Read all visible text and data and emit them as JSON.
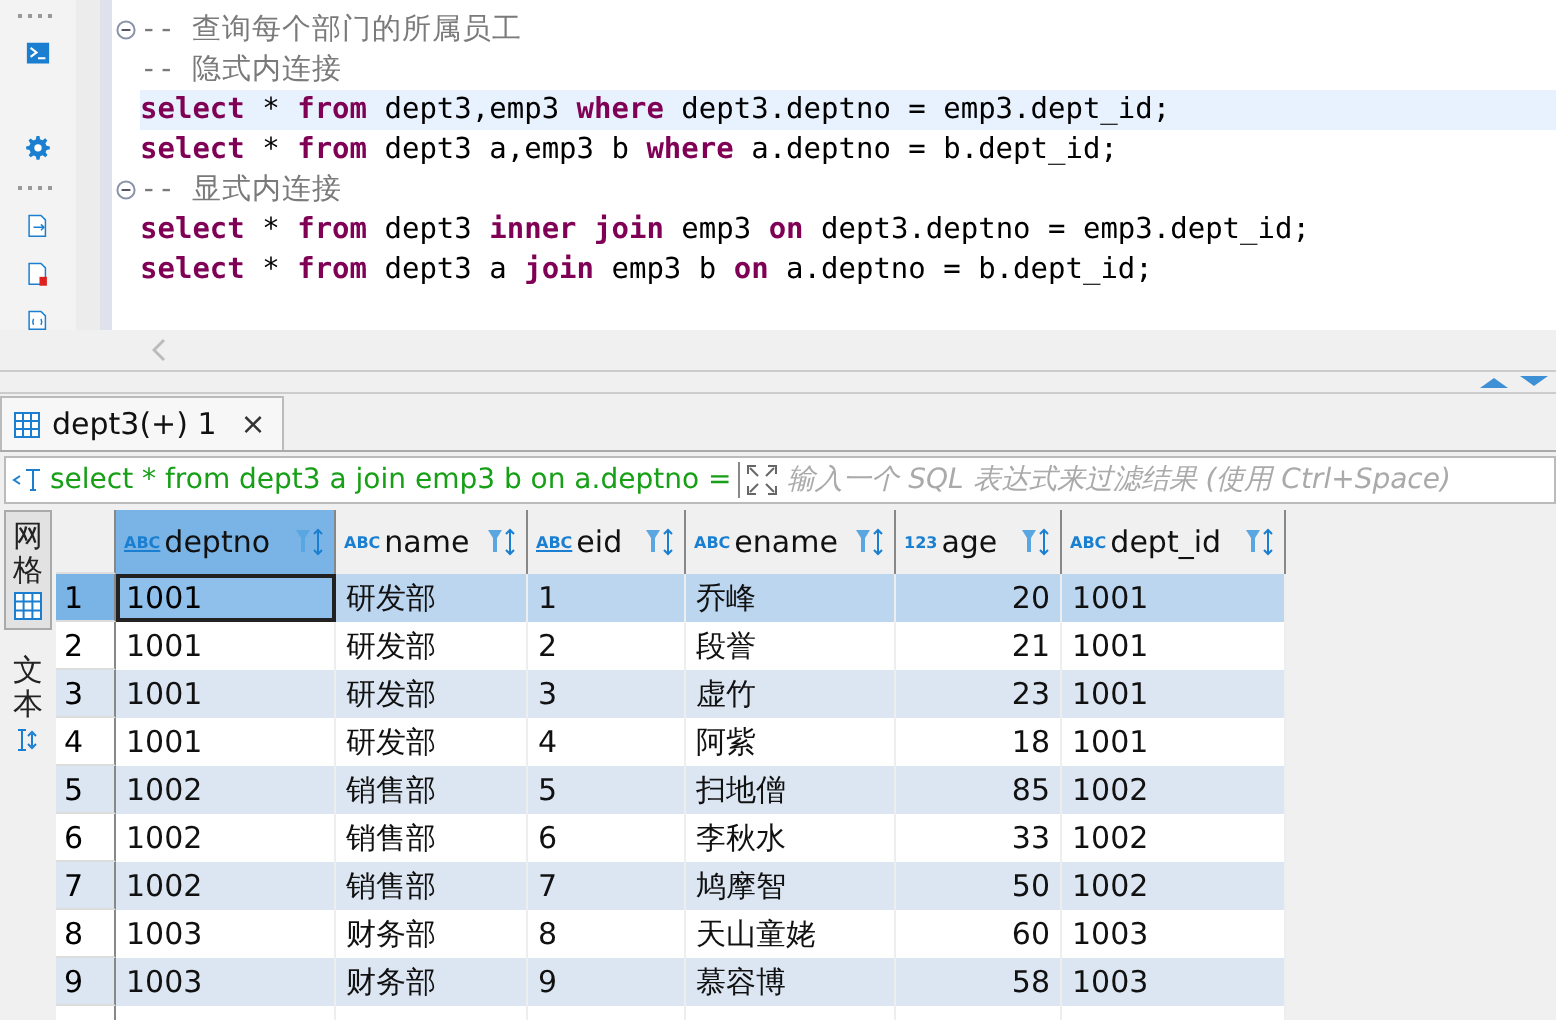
{
  "editor": {
    "lines": [
      {
        "fold": true,
        "current": false,
        "segments": [
          {
            "kind": "comment",
            "text": "-- 查询每个部门的所属员工"
          }
        ]
      },
      {
        "fold": false,
        "current": false,
        "segments": [
          {
            "kind": "comment",
            "text": "-- 隐式内连接"
          }
        ]
      },
      {
        "fold": false,
        "current": true,
        "segments": [
          {
            "kind": "keyword",
            "text": "select"
          },
          {
            "kind": "plain",
            "text": " * "
          },
          {
            "kind": "keyword",
            "text": "from"
          },
          {
            "kind": "plain",
            "text": " dept3,emp3 "
          },
          {
            "kind": "keyword",
            "text": "where"
          },
          {
            "kind": "plain",
            "text": " dept3.deptno = emp3.dept_id;"
          }
        ]
      },
      {
        "fold": false,
        "current": false,
        "segments": [
          {
            "kind": "keyword",
            "text": "select"
          },
          {
            "kind": "plain",
            "text": " * "
          },
          {
            "kind": "keyword",
            "text": "from"
          },
          {
            "kind": "plain",
            "text": " dept3 a,emp3 b "
          },
          {
            "kind": "keyword",
            "text": "where"
          },
          {
            "kind": "plain",
            "text": " a.deptno = b.dept_id;"
          }
        ]
      },
      {
        "fold": true,
        "current": false,
        "segments": [
          {
            "kind": "comment",
            "text": "-- 显式内连接"
          }
        ]
      },
      {
        "fold": false,
        "current": false,
        "segments": [
          {
            "kind": "keyword",
            "text": "select"
          },
          {
            "kind": "plain",
            "text": " * "
          },
          {
            "kind": "keyword",
            "text": "from"
          },
          {
            "kind": "plain",
            "text": " dept3 "
          },
          {
            "kind": "keyword",
            "text": "inner join"
          },
          {
            "kind": "plain",
            "text": " emp3 "
          },
          {
            "kind": "keyword",
            "text": "on"
          },
          {
            "kind": "plain",
            "text": " dept3.deptno = emp3.dept_id;"
          }
        ]
      },
      {
        "fold": false,
        "current": false,
        "segments": [
          {
            "kind": "keyword",
            "text": "select"
          },
          {
            "kind": "plain",
            "text": " * "
          },
          {
            "kind": "keyword",
            "text": "from"
          },
          {
            "kind": "plain",
            "text": " dept3 a "
          },
          {
            "kind": "keyword",
            "text": "join"
          },
          {
            "kind": "plain",
            "text": " emp3 b "
          },
          {
            "kind": "keyword",
            "text": "on"
          },
          {
            "kind": "plain",
            "text": " a.deptno = b.dept_id;"
          }
        ]
      }
    ]
  },
  "result_tab": {
    "title": "dept3(+) 1",
    "close": "×"
  },
  "filter": {
    "query": "select * from dept3 a join emp3 b on a.deptno =",
    "placeholder": "输入一个 SQL 表达式来过滤结果 (使用 Ctrl+Space)"
  },
  "view_tabs": [
    {
      "label": "网格",
      "selected": true
    },
    {
      "label": "文本",
      "selected": false
    }
  ],
  "table": {
    "columns": [
      {
        "name": "deptno",
        "kind": "key",
        "type_label": "ABC",
        "selected": true
      },
      {
        "name": "name",
        "kind": "text",
        "type_label": "ABC",
        "selected": false
      },
      {
        "name": "eid",
        "kind": "key",
        "type_label": "ABC",
        "selected": false
      },
      {
        "name": "ename",
        "kind": "text",
        "type_label": "ABC",
        "selected": false
      },
      {
        "name": "age",
        "kind": "number",
        "type_label": "123",
        "selected": false
      },
      {
        "name": "dept_id",
        "kind": "text",
        "type_label": "ABC",
        "selected": false
      }
    ],
    "rows": [
      {
        "number": "1",
        "selected": true,
        "cells": [
          "1001",
          "研发部",
          "1",
          "乔峰",
          "20",
          "1001"
        ]
      },
      {
        "number": "2",
        "selected": false,
        "cells": [
          "1001",
          "研发部",
          "2",
          "段誉",
          "21",
          "1001"
        ]
      },
      {
        "number": "3",
        "selected": false,
        "cells": [
          "1001",
          "研发部",
          "3",
          "虚竹",
          "23",
          "1001"
        ]
      },
      {
        "number": "4",
        "selected": false,
        "cells": [
          "1001",
          "研发部",
          "4",
          "阿紫",
          "18",
          "1001"
        ]
      },
      {
        "number": "5",
        "selected": false,
        "cells": [
          "1002",
          "销售部",
          "5",
          "扫地僧",
          "85",
          "1002"
        ]
      },
      {
        "number": "6",
        "selected": false,
        "cells": [
          "1002",
          "销售部",
          "6",
          "李秋水",
          "33",
          "1002"
        ]
      },
      {
        "number": "7",
        "selected": false,
        "cells": [
          "1002",
          "销售部",
          "7",
          "鸠摩智",
          "50",
          "1002"
        ]
      },
      {
        "number": "8",
        "selected": false,
        "cells": [
          "1003",
          "财务部",
          "8",
          "天山童姥",
          "60",
          "1003"
        ]
      },
      {
        "number": "9",
        "selected": false,
        "cells": [
          "1003",
          "财务部",
          "9",
          "慕容博",
          "58",
          "1003"
        ]
      }
    ]
  }
}
